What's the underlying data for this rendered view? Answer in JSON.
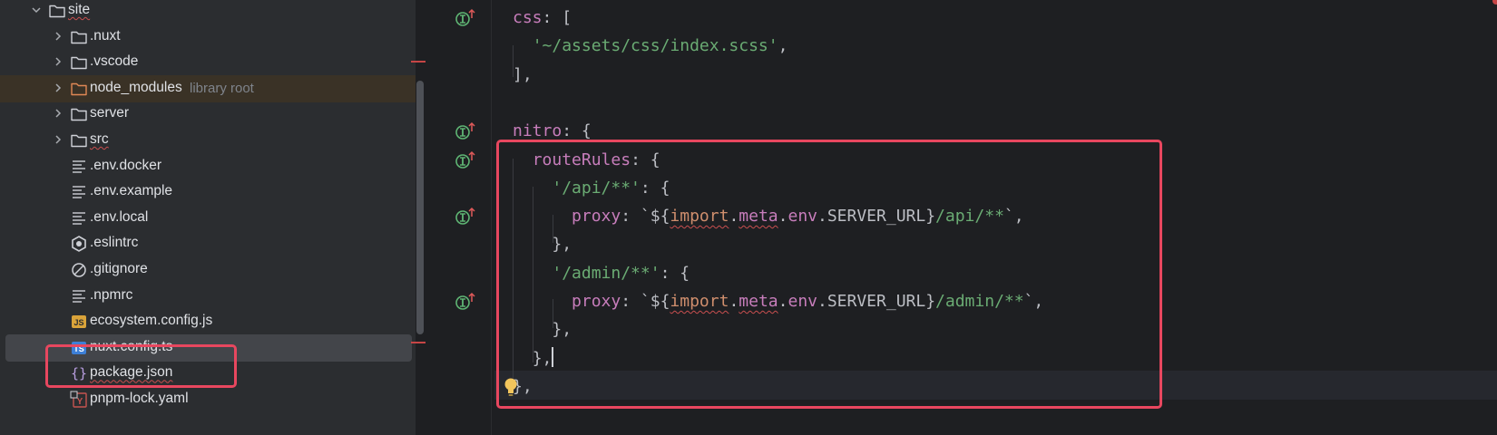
{
  "project_tree": {
    "rows": [
      {
        "label": "site",
        "icon": "folder-icon",
        "expanded": true,
        "wavy": true
      },
      {
        "label": ".nuxt",
        "icon": "folder-icon",
        "expanded": false
      },
      {
        "label": ".vscode",
        "icon": "folder-icon",
        "expanded": false
      },
      {
        "label": "node_modules",
        "suffix": "library root",
        "icon": "folder-orange-icon",
        "expanded": false
      },
      {
        "label": "server",
        "icon": "folder-icon",
        "expanded": false
      },
      {
        "label": "src",
        "icon": "folder-icon",
        "expanded": false,
        "wavy": true
      },
      {
        "label": ".env.docker",
        "icon": "text-file-icon"
      },
      {
        "label": ".env.example",
        "icon": "text-file-icon"
      },
      {
        "label": ".env.local",
        "icon": "text-file-icon"
      },
      {
        "label": ".eslintrc",
        "icon": "eslint-icon"
      },
      {
        "label": ".gitignore",
        "icon": "gitignore-icon"
      },
      {
        "label": ".npmrc",
        "icon": "text-file-icon"
      },
      {
        "label": "ecosystem.config.js",
        "icon": "js-file-icon"
      },
      {
        "label": "nuxt.config.ts",
        "icon": "ts-file-icon",
        "selected": true
      },
      {
        "label": "package.json",
        "icon": "json-file-icon",
        "wavy": true
      },
      {
        "label": "pnpm-lock.yaml",
        "icon": "yaml-file-icon"
      }
    ],
    "selected": "nuxt.config.ts"
  },
  "icon_labels": {
    "js": "JS",
    "ts": "TS"
  },
  "editor": {
    "lines": [
      [
        {
          "t": "css",
          "c": "k"
        },
        {
          "t": ": [",
          "c": "p"
        }
      ],
      [
        {
          "t": "  "
        },
        {
          "t": "'~/assets/css/index.scss'",
          "c": "s"
        },
        {
          "t": ",",
          "c": "p"
        }
      ],
      [
        {
          "t": "],",
          "c": "p"
        }
      ],
      [],
      [
        {
          "t": "nitro",
          "c": "k"
        },
        {
          "t": ": {",
          "c": "p"
        }
      ],
      [
        {
          "t": "  "
        },
        {
          "t": "routeRules",
          "c": "k"
        },
        {
          "t": ": {",
          "c": "p"
        }
      ],
      [
        {
          "t": "    "
        },
        {
          "t": "'/api/**'",
          "c": "s"
        },
        {
          "t": ": {",
          "c": "p"
        }
      ],
      [
        {
          "t": "      "
        },
        {
          "t": "proxy",
          "c": "k"
        },
        {
          "t": ": `${",
          "c": "p"
        },
        {
          "t": "import",
          "c": "o u"
        },
        {
          "t": ".",
          "c": "p"
        },
        {
          "t": "meta",
          "c": "k u"
        },
        {
          "t": ".",
          "c": "p"
        },
        {
          "t": "env",
          "c": "k"
        },
        {
          "t": ".SERVER_URL}",
          "c": "p"
        },
        {
          "t": "/api/**",
          "c": "s"
        },
        {
          "t": "`,",
          "c": "p"
        }
      ],
      [
        {
          "t": "    "
        },
        {
          "t": "},",
          "c": "p"
        }
      ],
      [
        {
          "t": "    "
        },
        {
          "t": "'/admin/**'",
          "c": "s"
        },
        {
          "t": ": {",
          "c": "p"
        }
      ],
      [
        {
          "t": "      "
        },
        {
          "t": "proxy",
          "c": "k"
        },
        {
          "t": ": `${",
          "c": "p"
        },
        {
          "t": "import",
          "c": "o u"
        },
        {
          "t": ".",
          "c": "p"
        },
        {
          "t": "meta",
          "c": "k u"
        },
        {
          "t": ".",
          "c": "p"
        },
        {
          "t": "env",
          "c": "k"
        },
        {
          "t": ".SERVER_URL}",
          "c": "p"
        },
        {
          "t": "/admin/**",
          "c": "s"
        },
        {
          "t": "`,",
          "c": "p"
        }
      ],
      [
        {
          "t": "    "
        },
        {
          "t": "},",
          "c": "p"
        }
      ],
      [
        {
          "t": "  "
        },
        {
          "t": "},",
          "c": "p"
        },
        {
          "t": "",
          "caret": true
        }
      ],
      [
        {
          "t": "},",
          "c": "p"
        }
      ]
    ],
    "gutter_marked_lines": [
      0,
      4,
      5,
      7,
      10
    ],
    "current_line": 12
  },
  "colors": {
    "highlight_box": "#e8475f",
    "keyword": "#c77dbb",
    "string": "#6aab73",
    "import_keyword": "#cf8e6d",
    "tree_background": "#2b2d30",
    "editor_background": "#1e1f22"
  }
}
